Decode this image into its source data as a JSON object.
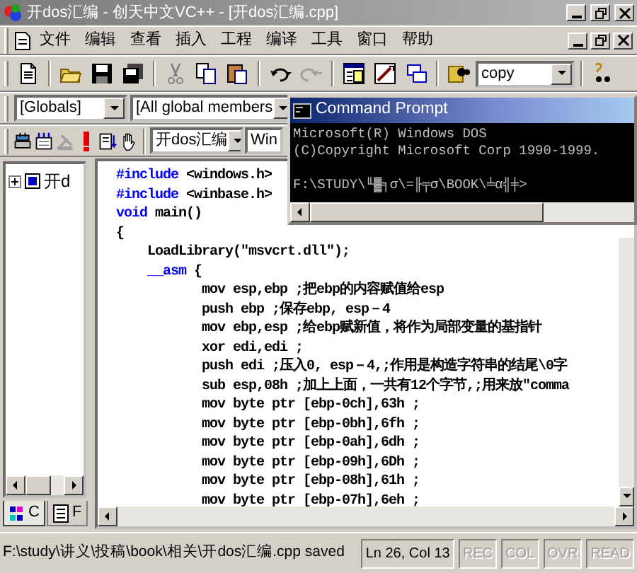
{
  "window": {
    "title": "开dos汇编 - 创天中文VC++ - [开dos汇编.cpp]"
  },
  "menu": {
    "items": [
      "文件",
      "编辑",
      "查看",
      "插入",
      "工程",
      "编译",
      "工具",
      "窗口",
      "帮助"
    ]
  },
  "toolbar": {
    "find_value": "copy"
  },
  "wizard_bar": {
    "class_value": "[Globals]",
    "member_value": "[All global members"
  },
  "build_bar": {
    "config_value": "开dos汇编",
    "platform_value": "Win"
  },
  "command_prompt": {
    "title": "Command Prompt",
    "lines": [
      {
        "kind": "output",
        "text": "Microsoft(R) Windows DOS"
      },
      {
        "kind": "output",
        "text": "(C)Copyright Microsoft Corp 1990-1999."
      },
      {
        "kind": "prompt",
        "text": "F:\\STUDY\\╙▓╕σ\\=╟╤σ\\BOOK\\╧α╣╪>"
      }
    ]
  },
  "workspace": {
    "tree": [
      {
        "label": "开d",
        "expanded": false
      }
    ],
    "tabs": [
      {
        "label": "C",
        "selected": true
      },
      {
        "label": "F",
        "selected": false
      }
    ]
  },
  "editor": {
    "lines": [
      [
        {
          "kind": "keyword",
          "text": "#include"
        },
        {
          "kind": "plain",
          "text": " <windows.h>"
        }
      ],
      [
        {
          "kind": "keyword",
          "text": "#include"
        },
        {
          "kind": "plain",
          "text": " <winbase.h>"
        }
      ],
      [
        {
          "kind": "keyword",
          "text": "void"
        },
        {
          "kind": "plain",
          "text": " main()"
        }
      ],
      [
        {
          "kind": "plain",
          "text": "{"
        }
      ],
      [
        {
          "kind": "plain",
          "text": "    LoadLibrary(\"msvcrt.dll\");"
        }
      ],
      [
        {
          "kind": "keyword",
          "text": "    __asm"
        },
        {
          "kind": "plain",
          "text": " {"
        }
      ],
      [
        {
          "kind": "plain",
          "text": "           mov esp,ebp ;把ebp的内容赋值给esp"
        }
      ],
      [
        {
          "kind": "plain",
          "text": "           push ebp ;保存ebp, esp－4"
        }
      ],
      [
        {
          "kind": "plain",
          "text": "           mov ebp,esp ;给ebp赋新值，将作为局部变量的基指针"
        }
      ],
      [
        {
          "kind": "plain",
          "text": "           xor edi,edi ;"
        }
      ],
      [
        {
          "kind": "plain",
          "text": "           push edi ;压入0, esp－4,;作用是构造字符串的结尾\\0字"
        }
      ],
      [
        {
          "kind": "plain",
          "text": "           sub esp,08h ;加上上面，一共有12个字节,;用来放\"comma"
        }
      ],
      [
        {
          "kind": "plain",
          "text": "           mov byte ptr [ebp-0ch],63h ;"
        }
      ],
      [
        {
          "kind": "plain",
          "text": "           mov byte ptr [ebp-0bh],6fh ;"
        }
      ],
      [
        {
          "kind": "plain",
          "text": "           mov byte ptr [ebp-0ah],6dh ;"
        }
      ],
      [
        {
          "kind": "plain",
          "text": "           mov byte ptr [ebp-09h],6Dh ;"
        }
      ],
      [
        {
          "kind": "plain",
          "text": "           mov byte ptr [ebp-08h],61h ;"
        }
      ],
      [
        {
          "kind": "plain",
          "text": "           mov byte ptr [ebp-07h],6eh ;"
        }
      ]
    ]
  },
  "status_bar": {
    "message": "F:\\study\\讲义\\投稿\\book\\相关\\开dos汇编.cpp saved",
    "position": "Ln 26, Col 13",
    "indicators": [
      {
        "label": "REC",
        "disabled": true
      },
      {
        "label": "COL",
        "disabled": true
      },
      {
        "label": "OVR",
        "disabled": true
      },
      {
        "label": "READ",
        "disabled": true
      }
    ]
  }
}
